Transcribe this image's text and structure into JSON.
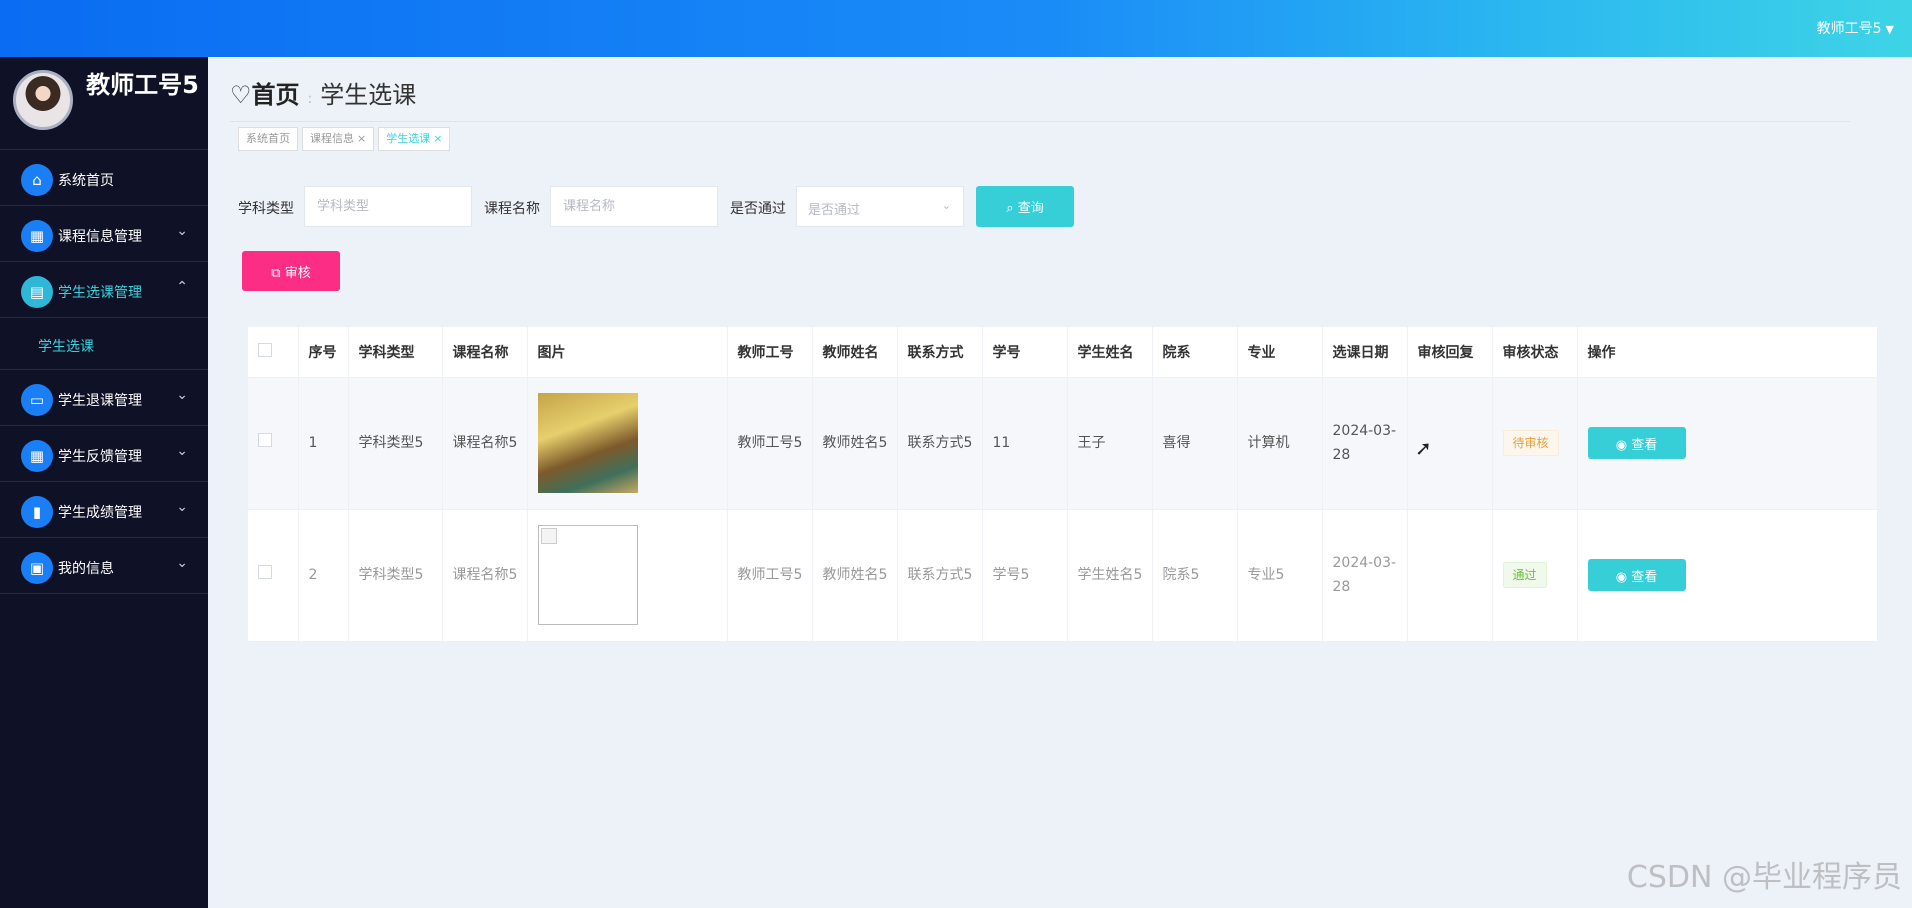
{
  "topbar": {
    "user": "教师工号5"
  },
  "sidebar": {
    "profile_name": "教师工号5",
    "items": [
      {
        "label": "系统首页",
        "icon": "home-icon"
      },
      {
        "label": "课程信息管理",
        "icon": "grid-icon"
      },
      {
        "label": "学生选课管理",
        "icon": "clipboard-icon"
      },
      {
        "label": "学生退课管理",
        "icon": "monitor-icon"
      },
      {
        "label": "学生反馈管理",
        "icon": "grid-icon"
      },
      {
        "label": "学生成绩管理",
        "icon": "bar-chart-icon"
      },
      {
        "label": "我的信息",
        "icon": "card-icon"
      }
    ],
    "sub_item": "学生选课"
  },
  "header": {
    "home": "首页",
    "current": "学生选课",
    "tags": [
      "系统首页",
      "课程信息",
      "学生选课"
    ]
  },
  "search": {
    "subject_label": "学科类型",
    "subject_placeholder": "学科类型",
    "course_label": "课程名称",
    "course_placeholder": "课程名称",
    "pass_label": "是否通过",
    "pass_placeholder": "是否通过",
    "query_button": "查询"
  },
  "audit_button": "审核",
  "table": {
    "headers": [
      "序号",
      "学科类型",
      "课程名称",
      "图片",
      "教师工号",
      "教师姓名",
      "联系方式",
      "学号",
      "学生姓名",
      "院系",
      "专业",
      "选课日期",
      "审核回复",
      "审核状态",
      "操作"
    ],
    "rows": [
      {
        "no": "1",
        "subject": "学科类型5",
        "course": "课程名称5",
        "teacher_id": "教师工号5",
        "teacher_name": "教师姓名5",
        "contact": "联系方式5",
        "student_no": "11",
        "student_name": "王子",
        "dept": "喜得",
        "major": "计算机",
        "date": "2024-03-28",
        "reply": "",
        "status": "待审核",
        "action": "查看"
      },
      {
        "no": "2",
        "subject": "学科类型5",
        "course": "课程名称5",
        "teacher_id": "教师工号5",
        "teacher_name": "教师姓名5",
        "contact": "联系方式5",
        "student_no": "学号5",
        "student_name": "学生姓名5",
        "dept": "院系5",
        "major": "专业5",
        "date": "2024-03-28",
        "reply": "",
        "status": "通过",
        "action": "查看"
      }
    ]
  },
  "watermark": "CSDN @毕业程序员",
  "colors": {
    "accent": "#36cfd8",
    "audit": "#fb2d84",
    "sidebar": "#0f1226",
    "primary": "#1a7ef6"
  }
}
